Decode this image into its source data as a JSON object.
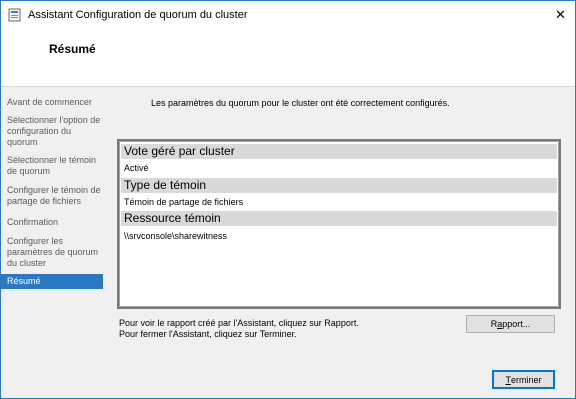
{
  "window": {
    "title": "Assistant Configuration de quorum du cluster",
    "close_glyph": "✕"
  },
  "header": {
    "title": "Résumé"
  },
  "sidebar": {
    "steps": [
      {
        "label": "Avant de commencer"
      },
      {
        "label": "Sélectionner l'option de configuration du quorum"
      },
      {
        "label": "Sélectionner le témoin de quorum"
      },
      {
        "label": "Configurer le témoin de partage de fichiers"
      },
      {
        "label": "Confirmation"
      },
      {
        "label": "Configurer les paramètres de quorum du cluster"
      },
      {
        "label": "Résumé"
      }
    ],
    "active_index": 6
  },
  "main": {
    "intro": "Les paramètres du quorum pour le cluster ont été correctement configurés.",
    "sections": [
      {
        "heading": "Vote géré par cluster",
        "value": "Activé"
      },
      {
        "heading": "Type de témoin",
        "value": "Témoin de partage de fichiers"
      },
      {
        "heading": "Ressource témoin",
        "value": "\\\\srvconsole\\sharewitness"
      }
    ],
    "footnote_report": "Pour voir le rapport créé par l'Assistant, cliquez sur Rapport.",
    "footnote_close": "Pour fermer l'Assistant, cliquez sur Terminer."
  },
  "buttons": {
    "report_prefix": "R",
    "report_underlined": "a",
    "report_suffix": "pport...",
    "finish_underlined": "T",
    "finish_suffix": "erminer"
  },
  "colors": {
    "accent": "#2b79c2",
    "section_bg": "#d9d9d9"
  }
}
